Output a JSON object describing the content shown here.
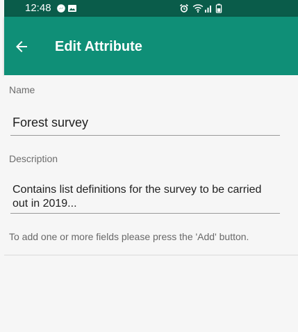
{
  "status_bar": {
    "time": "12:48",
    "background": "#0a5c4a",
    "icons": [
      "messenger-icon",
      "image-icon",
      "alarm-icon",
      "wifi-icon",
      "signal-icon",
      "battery-icon"
    ]
  },
  "app_bar": {
    "title": "Edit Attribute",
    "background": "#0f8f77",
    "back_icon": "back-arrow-icon"
  },
  "form": {
    "name_label": "Name",
    "name_value": "Forest survey",
    "description_label": "Description",
    "description_value": "Contains list definitions for the survey to be carried out in 2019...",
    "hint": "To add one or more fields please press the 'Add' button."
  }
}
